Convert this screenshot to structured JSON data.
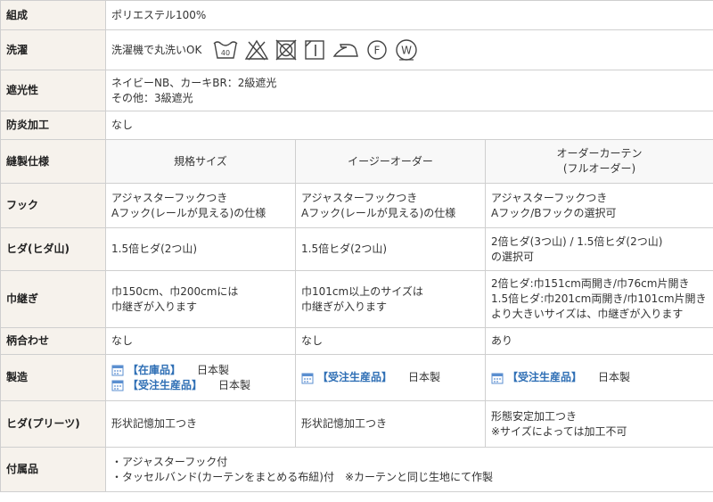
{
  "rows": {
    "composition": {
      "label": "組成",
      "value": "ポリエステル100%"
    },
    "washing": {
      "label": "洗濯",
      "value": "洗濯機で丸洗いOK",
      "wash_temp": "40",
      "icons": [
        "wash-40-icon",
        "no-bleach-icon",
        "no-tumble-dry-icon",
        "line-dry-shade-icon",
        "iron-low-icon",
        "dry-clean-f-icon",
        "wet-clean-w-icon"
      ]
    },
    "blackout": {
      "label": "遮光性",
      "lines": [
        "ネイビーNB、カーキBR：2級遮光",
        "その他：3級遮光"
      ]
    },
    "fireproof": {
      "label": "防炎加工",
      "value": "なし"
    },
    "sewing": {
      "label": "縫製仕様",
      "columns": [
        "規格サイズ",
        "イージーオーダー",
        "オーダーカーテン",
        "(フルオーダー)"
      ]
    },
    "hook": {
      "label": "フック",
      "c1": [
        "アジャスターフックつき",
        "Aフック(レールが見える)の仕様"
      ],
      "c2": [
        "アジャスターフックつき",
        "Aフック(レールが見える)の仕様"
      ],
      "c3": [
        "アジャスターフックつき",
        "Aフック/Bフックの選択可"
      ]
    },
    "pleat": {
      "label": "ヒダ(ヒダ山)",
      "c1": "1.5倍ヒダ(2つ山)",
      "c2": "1.5倍ヒダ(2つ山)",
      "c3": [
        "2倍ヒダ(3つ山) / 1.5倍ヒダ(2つ山)",
        "の選択可"
      ]
    },
    "seam": {
      "label": "巾継ぎ",
      "c1": [
        "巾150cm、巾200cmには",
        "巾継ぎが入ります"
      ],
      "c2": [
        "巾101cm以上のサイズは",
        "巾継ぎが入ります"
      ],
      "c3": [
        "2倍ヒダ:巾151cm両開き/巾76cm片開き",
        "1.5倍ヒダ:巾201cm両開き/巾101cm片開き",
        "より大きいサイズは、巾継ぎが入ります"
      ]
    },
    "pattern": {
      "label": "柄合わせ",
      "c1": "なし",
      "c2": "なし",
      "c3": "あり"
    },
    "manufacture": {
      "label": "製造",
      "stock_tag": "【在庫品】",
      "order_tag": "【受注生産品】",
      "origin": "日本製"
    },
    "pleats_shape": {
      "label": "ヒダ(プリーツ)",
      "c1": "形状記憶加工つき",
      "c2": "形状記憶加工つき",
      "c3": [
        "形態安定加工つき",
        "※サイズによっては加工不可"
      ]
    },
    "accessories": {
      "label": "付属品",
      "lines": [
        "・アジャスターフック付",
        "・タッセルバンド(カーテンをまとめる布紐)付　※カーテンと同じ生地にて作製"
      ]
    }
  },
  "colors": {
    "label_bg": "#f6f2ec",
    "border": "#cfcfcf",
    "accent": "#2f6fb5",
    "text": "#333333"
  }
}
